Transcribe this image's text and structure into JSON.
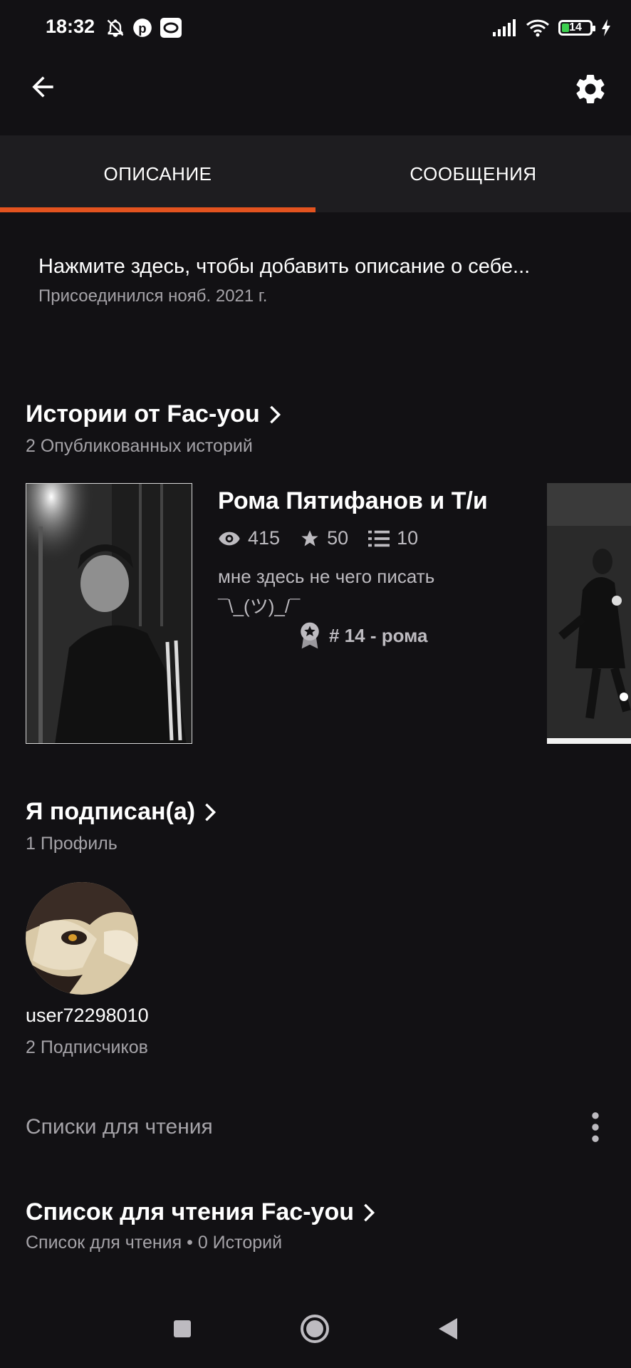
{
  "status_bar": {
    "time": "18:32",
    "battery": "14"
  },
  "tabs": [
    {
      "label": "ОПИСАНИЕ",
      "active": true
    },
    {
      "label": "СООБЩЕНИЯ",
      "active": false
    }
  ],
  "about": {
    "prompt": "Нажмите здесь, чтобы добавить описание о себе...",
    "joined": "Присоединился нояб. 2021 г."
  },
  "stories": {
    "title": "Истории от Fac-you",
    "subtitle": "2 Опубликованных историй",
    "items": [
      {
        "title": "Рома Пятифанов и Т/и",
        "views": "415",
        "votes": "50",
        "parts": "10",
        "description_line1": "мне здесь не чего писать",
        "description_line2": "¯\\_(ツ)_/¯",
        "rank": "# 14 - рома"
      }
    ]
  },
  "following": {
    "title": "Я подписан(а)",
    "subtitle": "1 Профиль",
    "profiles": [
      {
        "username": "user72298010",
        "followers": "2 Подписчиков"
      }
    ]
  },
  "reading_lists": {
    "section_label": "Списки для чтения",
    "items": [
      {
        "title": "Список для чтения Fac-you",
        "subtitle": "Список для чтения • 0 Историй"
      }
    ]
  },
  "colors": {
    "accent": "#e3531f",
    "background": "#121114",
    "tabbar": "#1e1d20"
  }
}
